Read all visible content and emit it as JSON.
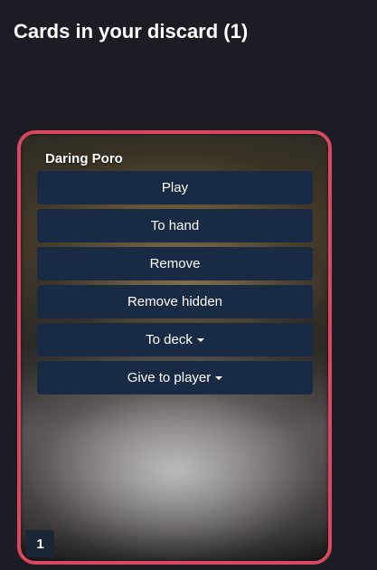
{
  "header": {
    "title": "Cards in your discard (1)"
  },
  "card": {
    "name": "Daring Poro",
    "count": "1",
    "border_color": "#d9485f",
    "actions": [
      {
        "label": "Play",
        "dropdown": false
      },
      {
        "label": "To hand",
        "dropdown": false
      },
      {
        "label": "Remove",
        "dropdown": false
      },
      {
        "label": "Remove hidden",
        "dropdown": false
      },
      {
        "label": "To deck",
        "dropdown": true
      },
      {
        "label": "Give to player",
        "dropdown": true
      }
    ]
  },
  "colors": {
    "background": "#1c1c24",
    "button": "#192a45"
  }
}
